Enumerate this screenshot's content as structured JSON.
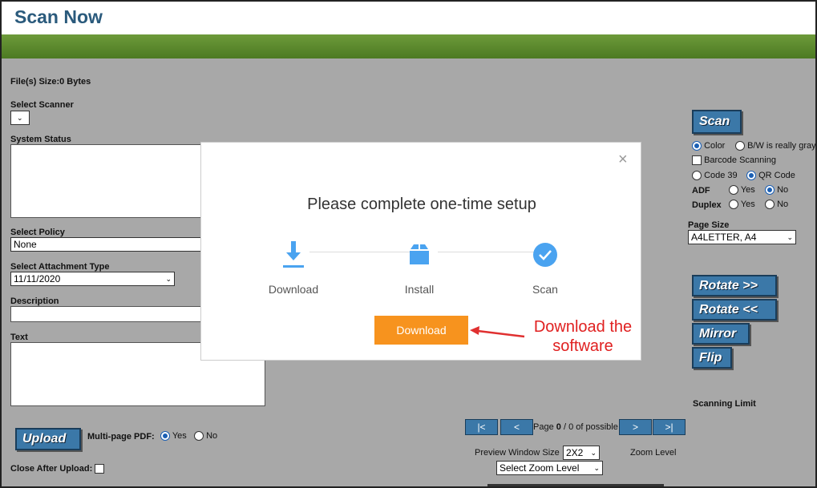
{
  "header": {
    "title": "Scan Now"
  },
  "left": {
    "file_size": "File(s) Size:0 Bytes",
    "select_scanner_label": "Select Scanner",
    "system_status_label": "System Status",
    "select_policy_label": "Select Policy",
    "policy_value": "None",
    "attachment_type_label": "Select Attachment Type",
    "attachment_value": "11/11/2020",
    "description_label": "Description",
    "text_label": "Text",
    "upload_label": "Upload",
    "multipage_label": "Multi-page PDF:",
    "yes": "Yes",
    "no": "No",
    "close_after_upload": "Close After Upload:"
  },
  "right": {
    "scan_label": "Scan",
    "color": "Color",
    "bw": "B/W is really gray",
    "barcode": "Barcode Scanning",
    "code39": "Code 39",
    "qrcode": "QR Code",
    "adf": "ADF",
    "duplex": "Duplex",
    "yes": "Yes",
    "no": "No",
    "page_size_label": "Page Size",
    "page_size_value": "A4LETTER, A4",
    "rotate_right": "Rotate >>",
    "rotate_left": "Rotate <<",
    "mirror": "Mirror",
    "flip": "Flip",
    "scanning_limit": "Scanning Limit"
  },
  "bottom": {
    "first": "|<",
    "prev": "<",
    "page_prefix": "Page",
    "page_current": "0",
    "page_suffix": "/ 0 of possible",
    "next": ">",
    "last": ">|",
    "preview_label": "Preview Window Size",
    "preview_value": "2X2",
    "zoom_label": "Zoom Level",
    "zoom_value": "Select Zoom Level"
  },
  "modal": {
    "title": "Please complete one-time setup",
    "close": "×",
    "steps": [
      {
        "label": "Download",
        "icon": "download-icon"
      },
      {
        "label": "Install",
        "icon": "box-icon"
      },
      {
        "label": "Scan",
        "icon": "check-circle-icon"
      }
    ],
    "button": "Download",
    "accent": "#f7931e",
    "icon_color": "#4aa3f0"
  },
  "annotation": {
    "line1": "Download the",
    "line2": "software"
  }
}
